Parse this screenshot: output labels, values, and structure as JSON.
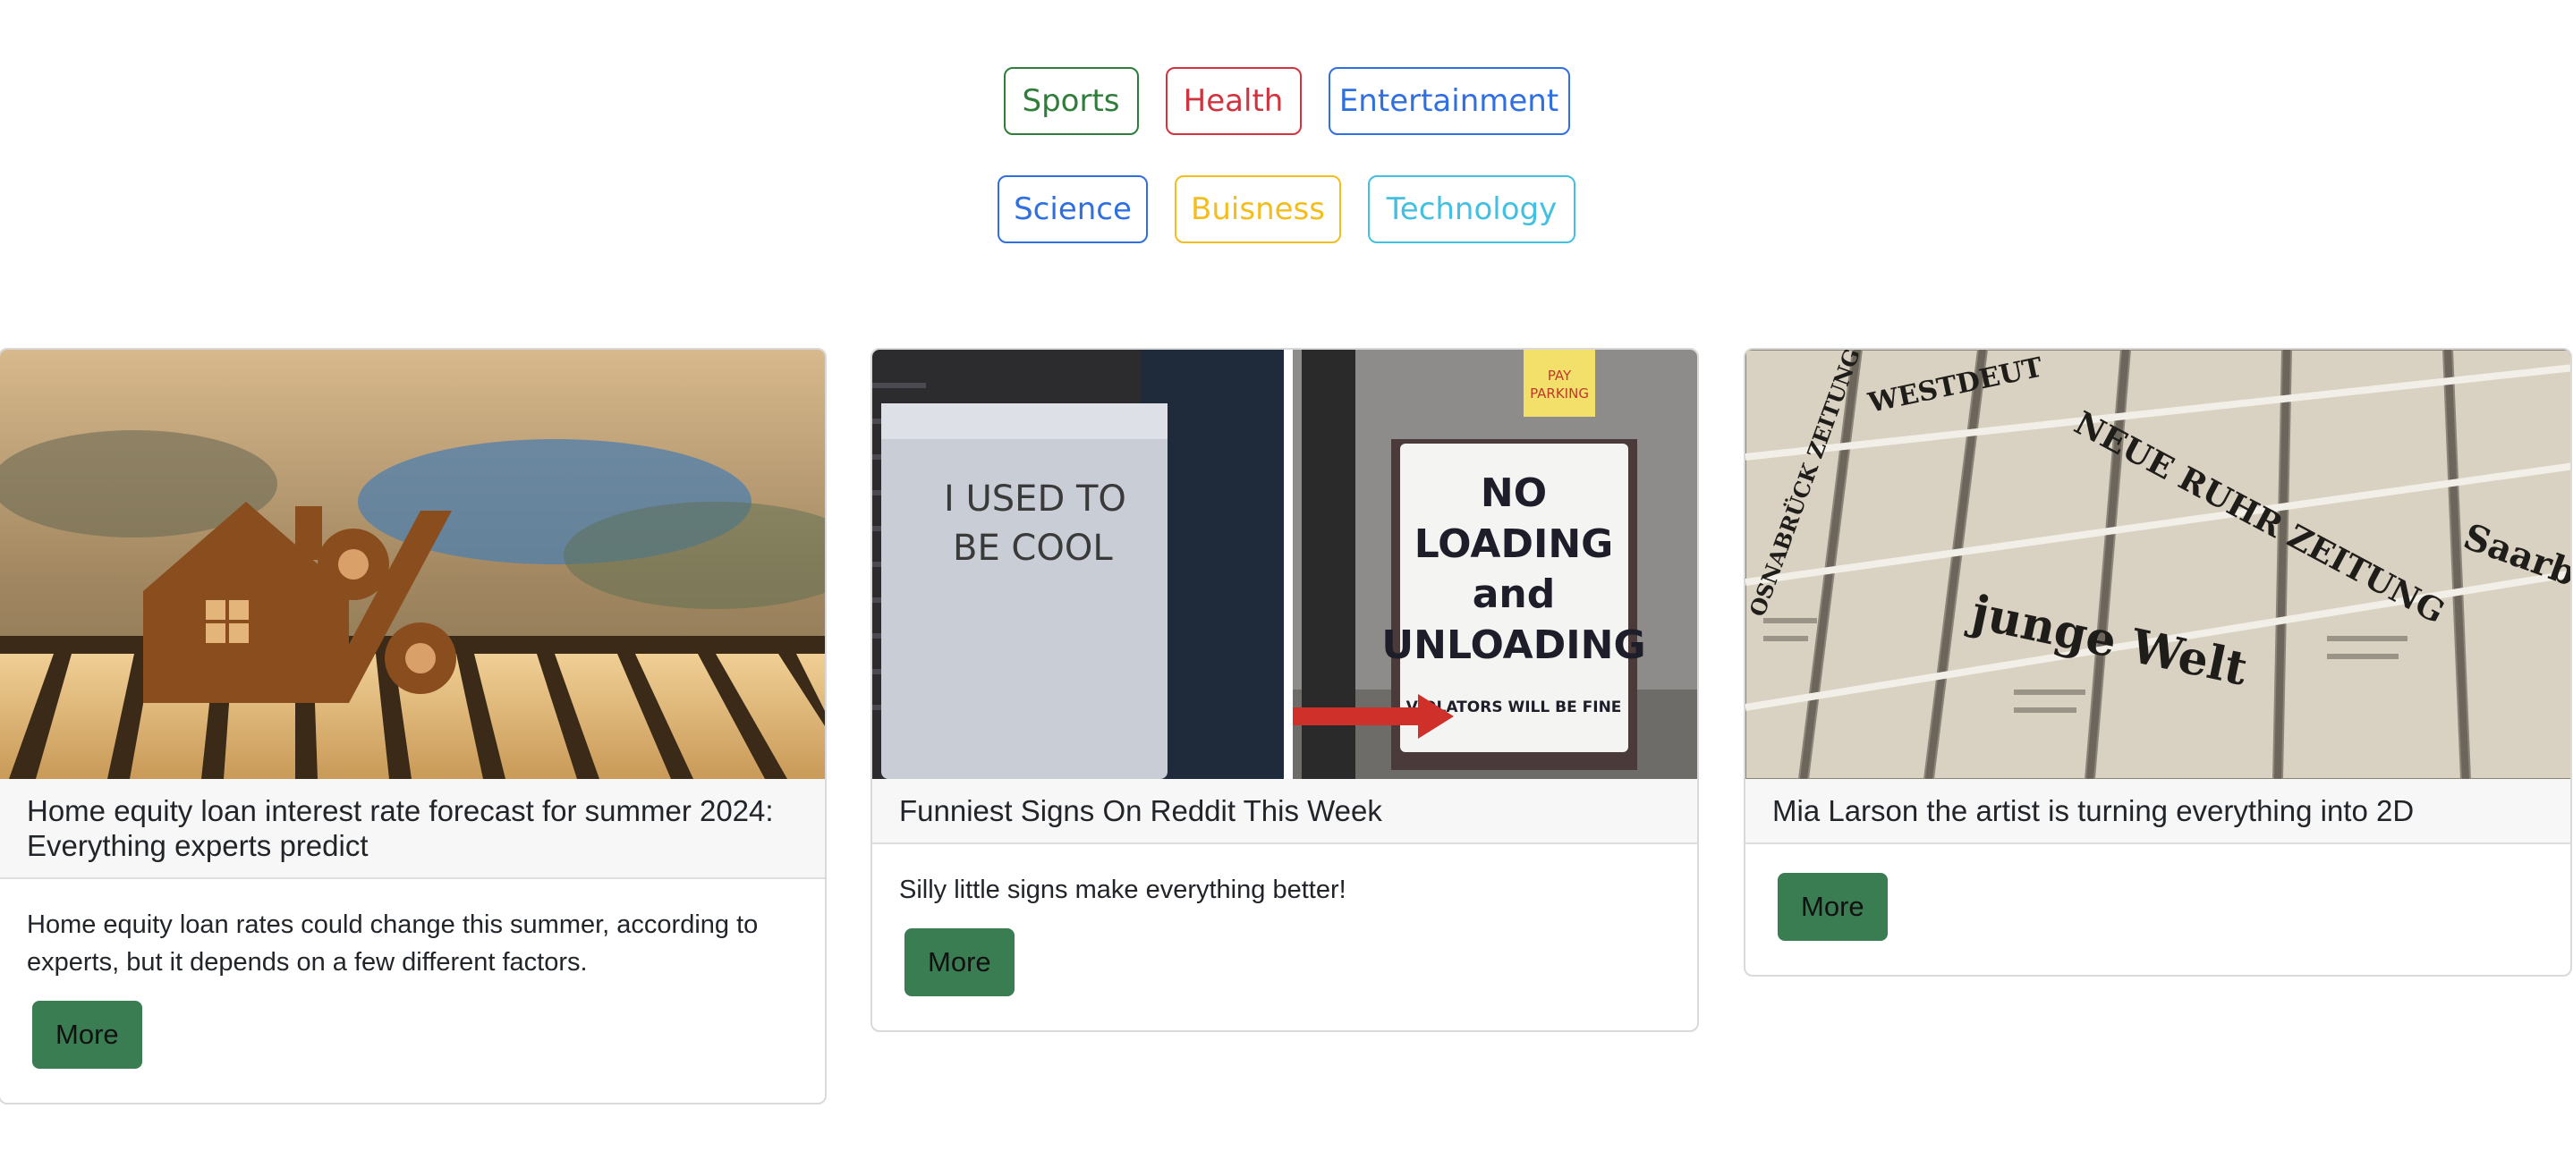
{
  "categories_row1": [
    {
      "label": "Sports",
      "color": "#2f7d3a"
    },
    {
      "label": "Health",
      "color": "#d0343f"
    },
    {
      "label": "Entertainment",
      "color": "#2f6fe0"
    }
  ],
  "categories_row2": [
    {
      "label": "Science",
      "color": "#2f6fe0"
    },
    {
      "label": "Buisness",
      "color": "#f2bd1d"
    },
    {
      "label": "Technology",
      "color": "#41c0e2"
    }
  ],
  "cards": [
    {
      "title": "Home equity loan interest rate forecast for summer 2024: Everything experts predict",
      "description": "Home equity loan rates could change this summer, according to experts, but it depends on a few different factors.",
      "button": "More",
      "image_icon": "house-percent-photo"
    },
    {
      "title": "Funniest Signs On Reddit This Week",
      "description": "Silly little signs make everything better!",
      "button": "More",
      "image_icon": "funny-signs-photo",
      "image_text": {
        "left": [
          "I USED TO",
          "BE COOL"
        ],
        "sign": [
          "NO",
          "LOADING",
          "and",
          "UNLOADING"
        ],
        "sign_small": "VIOLATORS WILL BE FINE",
        "small_sign": [
          "PAY",
          "PARKING"
        ]
      }
    },
    {
      "title": "Mia Larson the artist is turning everything into 2D",
      "description": "",
      "button": "More",
      "image_icon": "newspapers-photo",
      "image_text": [
        "WESTDEUT",
        "NEUE RUHR ZEITUNG",
        "junge Welt",
        "OSNABRÜCK ZEITUNG",
        "Saarbr"
      ]
    }
  ],
  "colors": {
    "more_button": "#3a7d52",
    "card_header": "#f7f7f7"
  }
}
